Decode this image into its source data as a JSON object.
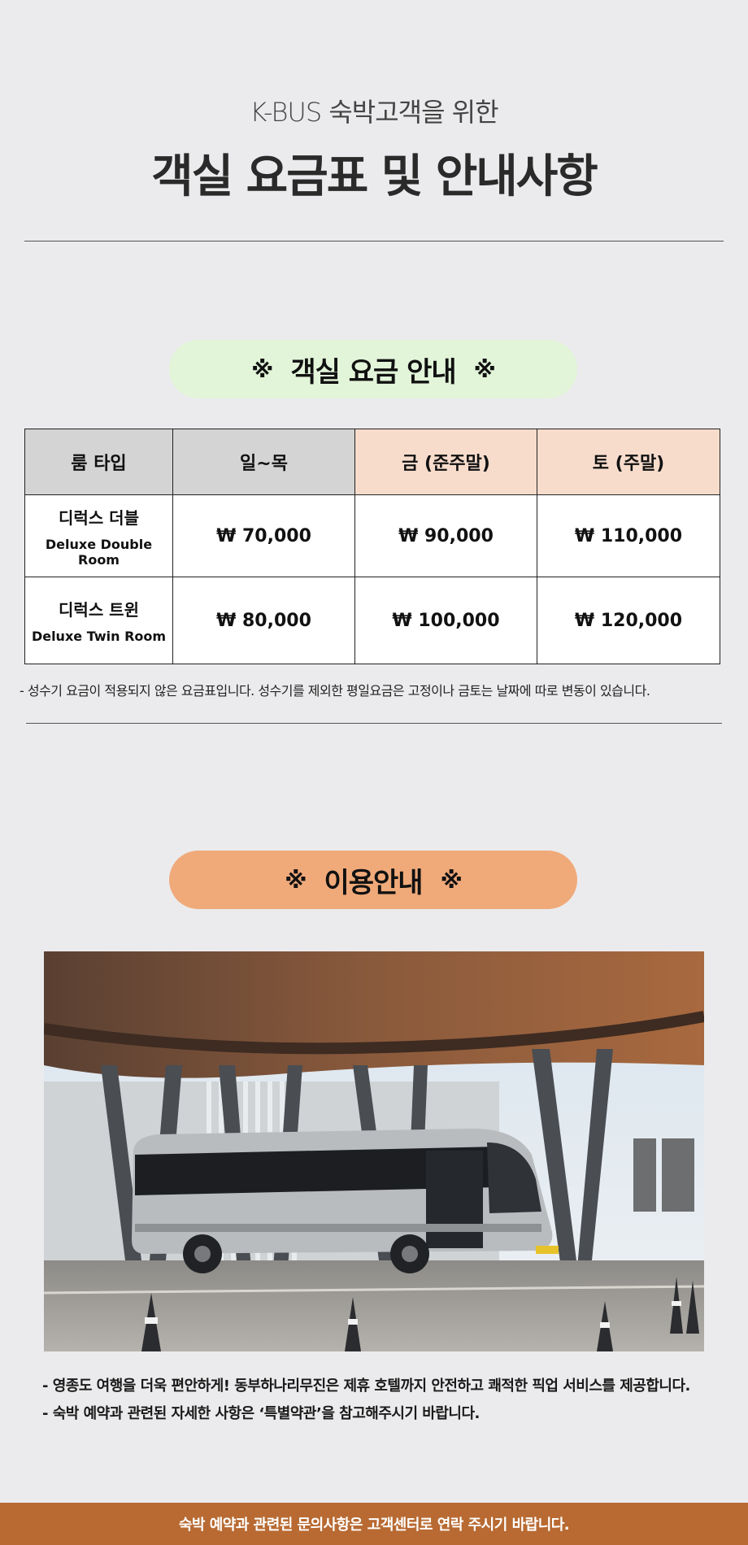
{
  "header": {
    "subtitle": "K-BUS 숙박고객을 위한",
    "title": "객실 요금표 및 안내사항"
  },
  "rates_section": {
    "mark_left": "※",
    "heading": "객실 요금 안내",
    "mark_right": "※",
    "pill_color": "#e2f5d9",
    "columns": [
      "룸 타입",
      "일~목",
      "금 (준주말)",
      "토 (주말)"
    ],
    "rows": [
      {
        "name_ko": "디럭스 더블",
        "name_en": "Deluxe Double Room",
        "prices": [
          "₩ 70,000",
          "₩ 90,000",
          "₩ 110,000"
        ]
      },
      {
        "name_ko": "디럭스 트윈",
        "name_en": "Deluxe Twin Room",
        "prices": [
          "₩ 80,000",
          "₩ 100,000",
          "₩ 120,000"
        ]
      }
    ],
    "note": "-  성수기 요금이 적용되지 않은 요금표입니다. 성수기를 제외한 평일요금은 고정이나 금토는 날짜에 따로 변동이 있습니다."
  },
  "usage_section": {
    "mark_left": "※",
    "heading": "이용안내",
    "mark_right": "※",
    "pill_color": "#f0aa7a",
    "photo_icon": "shuttle-bus-photo",
    "lines": [
      "- 영종도 여행을 더욱 편안하게! 동부하나리무진은 제휴 호텔까지 안전하고 쾌적한 픽업 서비스를 제공합니다.",
      "- 숙박 예약과 관련된 자세한 사항은 ‘특별약관’을 참고해주시기 바랍니다."
    ]
  },
  "footer": {
    "text": "숙박 예약과 관련된 문의사항은 고객센터로 연락 주시기 바랍니다.",
    "color": "#b86a32"
  }
}
